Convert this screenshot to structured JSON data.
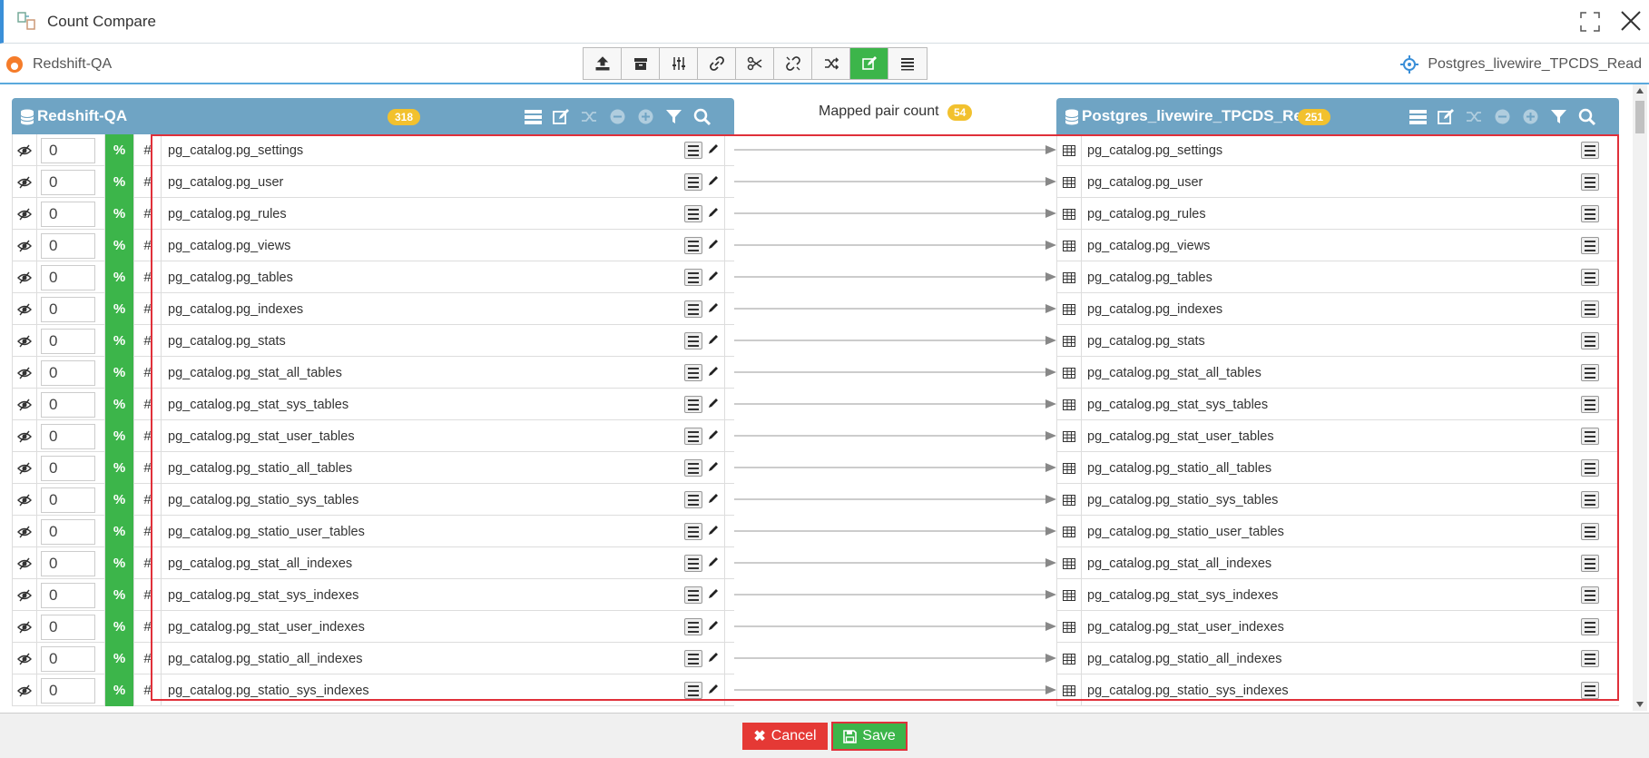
{
  "window": {
    "title": "Count Compare"
  },
  "toolbar": {
    "source_connection": "Redshift-QA",
    "target_connection": "Postgres_livewire_TPCDS_Read",
    "tools": [
      {
        "name": "upload-icon"
      },
      {
        "name": "archive-icon"
      },
      {
        "name": "sliders-icon"
      },
      {
        "name": "link-icon"
      },
      {
        "name": "scissors-icon"
      },
      {
        "name": "unlink-icon"
      },
      {
        "name": "shuffle-icon"
      },
      {
        "name": "edit-icon",
        "active": true
      },
      {
        "name": "list-icon"
      }
    ]
  },
  "source_panel": {
    "title": "Redshift-QA",
    "count": "318"
  },
  "target_panel": {
    "title": "Postgres_livewire_TPCDS_Re",
    "count": "251"
  },
  "mapping": {
    "label": "Mapped pair count",
    "count": "54"
  },
  "rows": [
    {
      "count": "0",
      "pct": "%",
      "hash": "#",
      "source": "pg_catalog.pg_settings",
      "target": "pg_catalog.pg_settings"
    },
    {
      "count": "0",
      "pct": "%",
      "hash": "#",
      "source": "pg_catalog.pg_user",
      "target": "pg_catalog.pg_user"
    },
    {
      "count": "0",
      "pct": "%",
      "hash": "#",
      "source": "pg_catalog.pg_rules",
      "target": "pg_catalog.pg_rules"
    },
    {
      "count": "0",
      "pct": "%",
      "hash": "#",
      "source": "pg_catalog.pg_views",
      "target": "pg_catalog.pg_views"
    },
    {
      "count": "0",
      "pct": "%",
      "hash": "#",
      "source": "pg_catalog.pg_tables",
      "target": "pg_catalog.pg_tables"
    },
    {
      "count": "0",
      "pct": "%",
      "hash": "#",
      "source": "pg_catalog.pg_indexes",
      "target": "pg_catalog.pg_indexes"
    },
    {
      "count": "0",
      "pct": "%",
      "hash": "#",
      "source": "pg_catalog.pg_stats",
      "target": "pg_catalog.pg_stats"
    },
    {
      "count": "0",
      "pct": "%",
      "hash": "#",
      "source": "pg_catalog.pg_stat_all_tables",
      "target": "pg_catalog.pg_stat_all_tables"
    },
    {
      "count": "0",
      "pct": "%",
      "hash": "#",
      "source": "pg_catalog.pg_stat_sys_tables",
      "target": "pg_catalog.pg_stat_sys_tables"
    },
    {
      "count": "0",
      "pct": "%",
      "hash": "#",
      "source": "pg_catalog.pg_stat_user_tables",
      "target": "pg_catalog.pg_stat_user_tables"
    },
    {
      "count": "0",
      "pct": "%",
      "hash": "#",
      "source": "pg_catalog.pg_statio_all_tables",
      "target": "pg_catalog.pg_statio_all_tables"
    },
    {
      "count": "0",
      "pct": "%",
      "hash": "#",
      "source": "pg_catalog.pg_statio_sys_tables",
      "target": "pg_catalog.pg_statio_sys_tables"
    },
    {
      "count": "0",
      "pct": "%",
      "hash": "#",
      "source": "pg_catalog.pg_statio_user_tables",
      "target": "pg_catalog.pg_statio_user_tables"
    },
    {
      "count": "0",
      "pct": "%",
      "hash": "#",
      "source": "pg_catalog.pg_stat_all_indexes",
      "target": "pg_catalog.pg_stat_all_indexes"
    },
    {
      "count": "0",
      "pct": "%",
      "hash": "#",
      "source": "pg_catalog.pg_stat_sys_indexes",
      "target": "pg_catalog.pg_stat_sys_indexes"
    },
    {
      "count": "0",
      "pct": "%",
      "hash": "#",
      "source": "pg_catalog.pg_stat_user_indexes",
      "target": "pg_catalog.pg_stat_user_indexes"
    },
    {
      "count": "0",
      "pct": "%",
      "hash": "#",
      "source": "pg_catalog.pg_statio_all_indexes",
      "target": "pg_catalog.pg_statio_all_indexes"
    },
    {
      "count": "0",
      "pct": "%",
      "hash": "#",
      "source": "pg_catalog.pg_statio_sys_indexes",
      "target": "pg_catalog.pg_statio_sys_indexes"
    }
  ],
  "footer": {
    "cancel_label": "Cancel",
    "save_label": "Save"
  },
  "colors": {
    "header": "#6fa4c4",
    "accent_green": "#3cb54a",
    "badge": "#f2c12e",
    "cancel": "#e53935",
    "highlight": "#e0303a"
  }
}
